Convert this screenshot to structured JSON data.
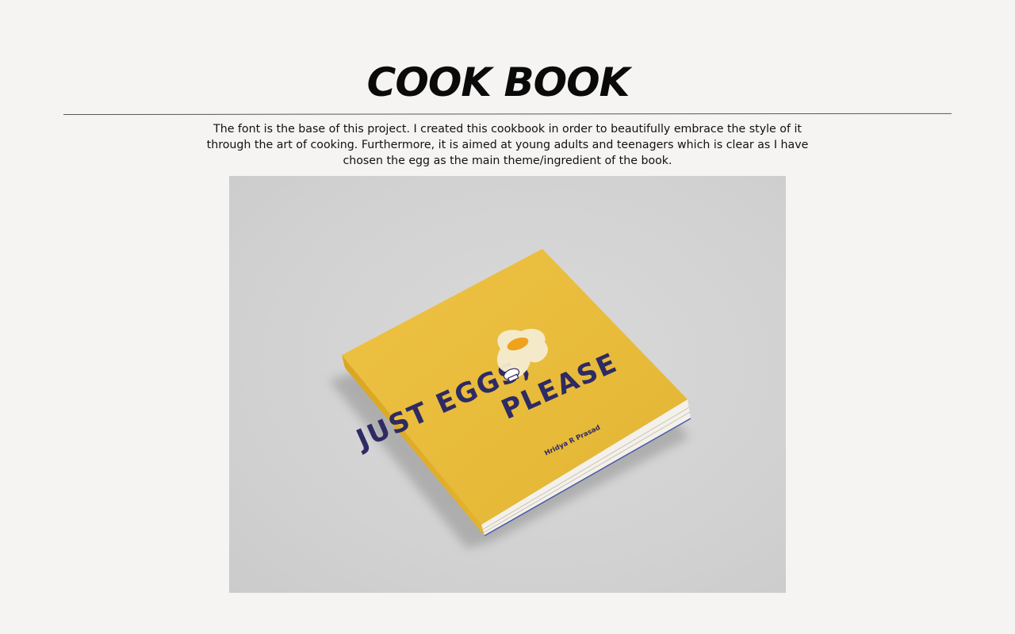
{
  "title": "COOK BOOK",
  "description": "The font is the base of this project. I created this cookbook in order to beautifully embrace the style of it through the art of cooking. Furthermore, it is aimed at young adults and teenagers which is clear as I have chosen the egg as the main theme/ingredient of the book.",
  "book": {
    "title_line1": "JUST EGGS,",
    "title_line2": "PLEASE",
    "author": "Hridya R Prasad"
  },
  "colors": {
    "background": "#f5f4f2",
    "book_cover": "#e8bd3a",
    "cover_text": "#2e2a63",
    "yolk": "#f0a21c"
  }
}
